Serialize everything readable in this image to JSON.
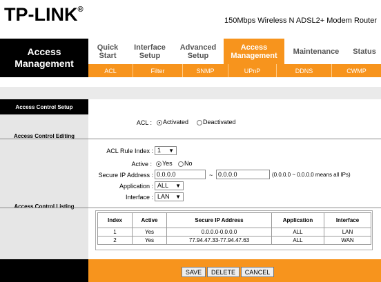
{
  "brand": {
    "logo": "TP-LINK",
    "registered": "®",
    "model": "150Mbps Wireless N ADSL2+ Modem Router"
  },
  "page_title": {
    "line1": "Access",
    "line2": "Management"
  },
  "nav": [
    {
      "line1": "Quick",
      "line2": "Start"
    },
    {
      "line1": "Interface",
      "line2": "Setup"
    },
    {
      "line1": "Advanced",
      "line2": "Setup"
    },
    {
      "line1": "Access",
      "line2": "Management"
    },
    {
      "line1": "Maintenance",
      "line2": ""
    },
    {
      "line1": "Status",
      "line2": ""
    }
  ],
  "subnav": [
    "ACL",
    "Filter",
    "SNMP",
    "UPnP",
    "DDNS",
    "CWMP"
  ],
  "sections": {
    "setup": "Access Control Setup",
    "editing": "Access Control Editing",
    "listing": "Access Control Listing"
  },
  "acl": {
    "label": "ACL :",
    "opt_on": "Activated",
    "opt_off": "Deactivated"
  },
  "form": {
    "rule_index_label": "ACL Rule Index :",
    "rule_index_value": "1",
    "active_label": "Active :",
    "active_yes": "Yes",
    "active_no": "No",
    "secure_ip_label": "Secure IP Address :",
    "ip_start": "0.0.0.0",
    "ip_sep": "~",
    "ip_end": "0.0.0.0",
    "ip_hint": "(0.0.0.0 ~ 0.0.0.0 means all IPs)",
    "application_label": "Application :",
    "application_value": "ALL",
    "interface_label": "Interface :",
    "interface_value": "LAN",
    "arrow": "▼"
  },
  "table": {
    "headers": [
      "Index",
      "Active",
      "Secure IP Address",
      "Application",
      "Interface"
    ],
    "rows": [
      [
        "1",
        "Yes",
        "0.0.0.0-0.0.0.0",
        "ALL",
        "LAN"
      ],
      [
        "2",
        "Yes",
        "77.94.47.33-77.94.47.63",
        "ALL",
        "WAN"
      ]
    ]
  },
  "buttons": {
    "save": "SAVE",
    "delete": "DELETE",
    "cancel": "CANCEL"
  },
  "colors": {
    "accent": "#f7941d",
    "dark": "#000000"
  }
}
